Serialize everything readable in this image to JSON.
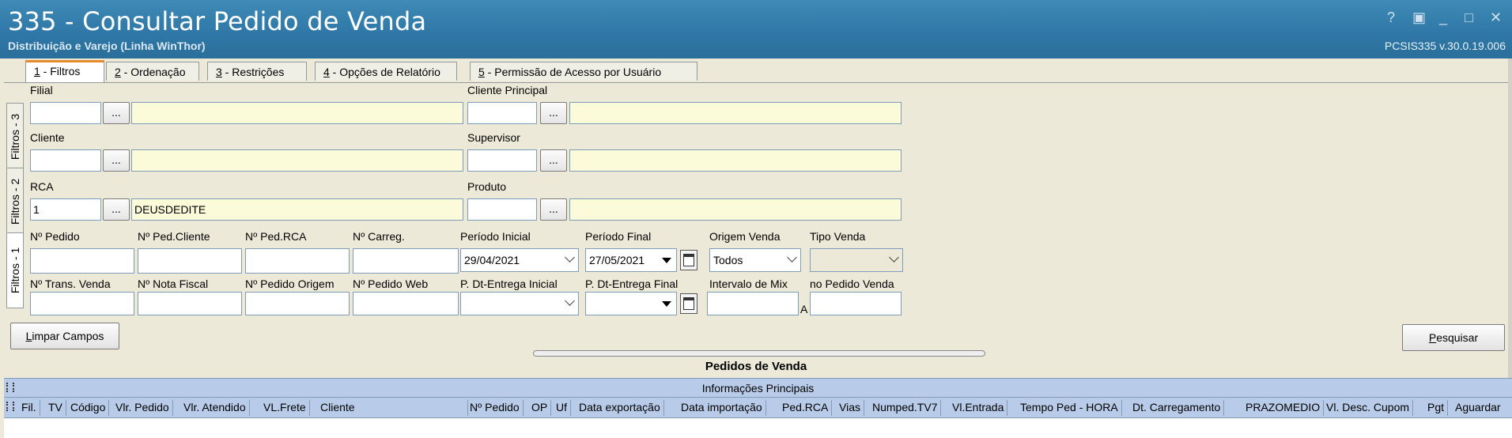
{
  "window": {
    "title": "335 - Consultar Pedido de Venda",
    "subtitle": "Distribuição e Varejo (Linha WinThor)",
    "version": "PCSIS335  v.30.0.19.006",
    "controls": [
      "?",
      "▣",
      "_",
      "□",
      "✕"
    ]
  },
  "tabs": [
    {
      "key": "1",
      "label": " - Filtros"
    },
    {
      "key": "2",
      "label": " - Ordenação"
    },
    {
      "key": "3",
      "label": " - Restrições"
    },
    {
      "key": "4",
      "label": " - Opções de Relatório"
    },
    {
      "key": "5",
      "label": " - Permissão de Acesso por Usuário"
    }
  ],
  "side_tabs": [
    "Filtros - 3",
    "Filtros - 2",
    "Filtros - 1"
  ],
  "filters": {
    "filial": {
      "label": "Filial",
      "code": "",
      "desc": ""
    },
    "cliente_principal": {
      "label": "Cliente Principal",
      "code": "",
      "desc": ""
    },
    "cliente": {
      "label": "Cliente",
      "code": "",
      "desc": ""
    },
    "supervisor": {
      "label": "Supervisor",
      "code": "",
      "desc": ""
    },
    "rca": {
      "label": "RCA",
      "code": "1",
      "desc": "DEUSDEDITE"
    },
    "produto": {
      "label": "Produto",
      "code": "",
      "desc": ""
    },
    "lookup_button": "...",
    "row1_labels": [
      "Nº Pedido",
      "Nº Ped.Cliente",
      "Nº Ped.RCA",
      "Nº Carreg."
    ],
    "row2_labels": [
      "Nº Trans. Venda",
      "Nº Nota Fiscal",
      "Nº Pedido Origem",
      "Nº Pedido Web"
    ],
    "periodo_inicial": {
      "label": "Período Inicial",
      "value": "29/04/2021"
    },
    "periodo_final": {
      "label": "Período Final",
      "value": "27/05/2021"
    },
    "origem_venda": {
      "label": "Origem Venda",
      "value": "Todos"
    },
    "tipo_venda": {
      "label": "Tipo Venda",
      "value": ""
    },
    "dt_entrega_inicial": {
      "label": "P. Dt-Entrega Inicial",
      "value": ""
    },
    "dt_entrega_final": {
      "label": "P. Dt-Entrega Final",
      "value": ""
    },
    "intervalo_mix": {
      "label": "Intervalo de Mix",
      "separator": "A",
      "from": "",
      "to": ""
    },
    "no_pedido_venda_label": "no Pedido Venda"
  },
  "buttons": {
    "limpar_key": "L",
    "limpar_rest": "impar Campos",
    "pesquisar_key": "P",
    "pesquisar_rest": "esquisar"
  },
  "grid": {
    "title": "Pedidos de  Venda",
    "band": "Informações Principais",
    "columns": [
      "Fil.",
      "TV",
      "Código",
      "Vlr. Pedido",
      "Vlr. Atendido",
      "VL.Frete",
      "Cliente",
      "Nº Pedido",
      "OP",
      "Uf",
      "Data exportação",
      "Data importação",
      "Ped.RCA",
      "Vias",
      "Numped.TV7",
      "Vl.Entrada",
      "Tempo Ped - HORA",
      "Dt. Carregamento",
      "PRAZOMEDIO",
      "Vl. Desc. Cupom",
      "Pgt",
      "Aguardar"
    ]
  },
  "colors": {
    "title_bar": "#2f78a7",
    "active_tab_accent": "#e68b2c",
    "lookup_fill": "#fbfbd9",
    "grid_header": "#b8cbe8"
  }
}
